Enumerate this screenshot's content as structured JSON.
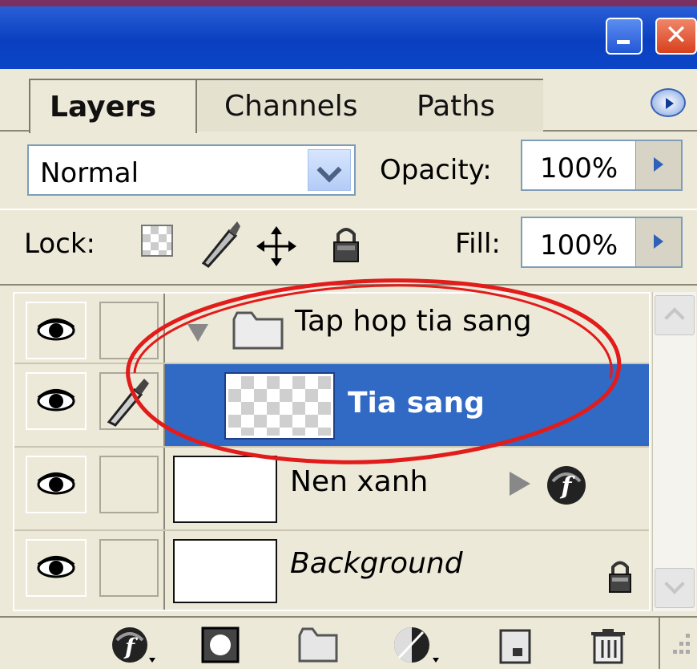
{
  "panel": {
    "tabs": [
      {
        "label": "Layers",
        "active": true
      },
      {
        "label": "Channels",
        "active": false
      },
      {
        "label": "Paths",
        "active": false
      }
    ]
  },
  "blend": {
    "mode": "Normal"
  },
  "opacity": {
    "label": "Opacity:",
    "value": "100%"
  },
  "lock": {
    "label": "Lock:"
  },
  "fill": {
    "label": "Fill:",
    "value": "100%"
  },
  "layers": [
    {
      "name": "Tap hop tia sang",
      "type": "group",
      "visible": true,
      "expanded": true,
      "selected": false
    },
    {
      "name": "Tia sang",
      "type": "layer",
      "visible": true,
      "selected": true,
      "editing": true
    },
    {
      "name": "Nen xanh",
      "type": "layer",
      "visible": true,
      "selected": false,
      "has_effects": true
    },
    {
      "name": "Background",
      "type": "background",
      "visible": true,
      "selected": false,
      "locked": true
    }
  ],
  "colors": {
    "selection": "#316ac5",
    "highlight_circle": "#e21b1b"
  }
}
